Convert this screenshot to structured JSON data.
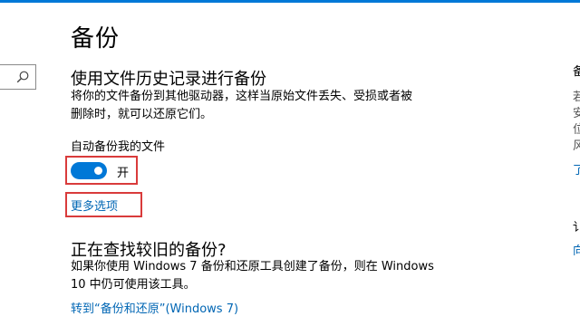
{
  "nav": {
    "search_placeholder": ""
  },
  "page": {
    "title": "备份"
  },
  "file_history": {
    "title": "使用文件历史记录进行备份",
    "description_line1": "将你的文件备份到其他驱动器，这样当原始文件丢失、受损或者被",
    "description_line2": "删除时，就可以还原它们。",
    "auto_backup_label": "自动备份我的文件",
    "toggle_on": true,
    "toggle_state_label": "开",
    "more_options_label": "更多选项"
  },
  "older_backup": {
    "title": "正在查找较旧的备份?",
    "description_line1": "如果你使用 Windows 7 备份和还原工具创建了备份，则在 Windows",
    "description_line2": "10 中仍可使用该工具。",
    "link_label": "转到“备份和还原”(Windows 7)"
  },
  "right_column": {
    "heading": "备",
    "line1": "若",
    "line2": "安",
    "line3": "位",
    "line4": "风",
    "link1": "了",
    "heading2": "讠",
    "link2": "向"
  },
  "colors": {
    "accent": "#0078d7",
    "link": "#0066b4",
    "highlight_border": "#d93b3b"
  }
}
